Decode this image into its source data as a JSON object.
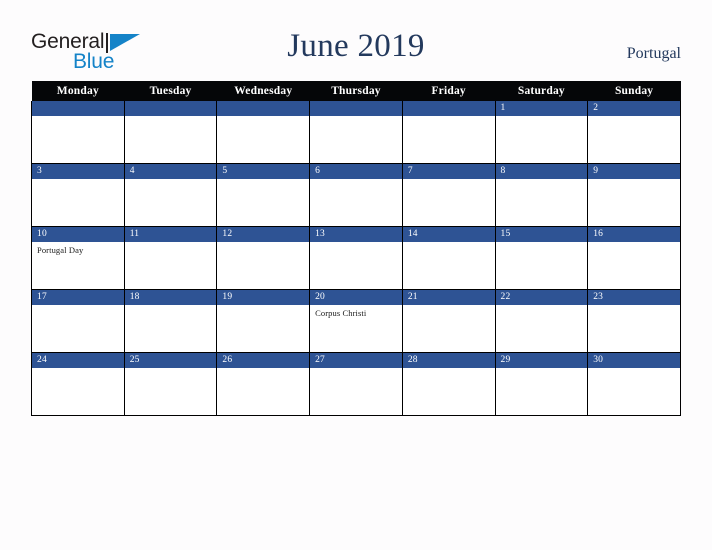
{
  "logo": {
    "word_one": "General",
    "word_two": "Blue",
    "mark": "triangle-logo-mark"
  },
  "header": {
    "title": "June 2019",
    "country": "Portugal"
  },
  "colors": {
    "accent_blue": "#2e5394",
    "logo_blue": "#1583c8",
    "title_navy": "#23395d",
    "header_row": "#050608",
    "page_background": "#fdfcfd",
    "cell_background": "#ffffff",
    "grid_line": "#000000"
  },
  "calendar": {
    "month": "June",
    "year": "2019",
    "weekday_headers": [
      "Monday",
      "Tuesday",
      "Wednesday",
      "Thursday",
      "Friday",
      "Saturday",
      "Sunday"
    ],
    "weeks": [
      [
        {
          "day": "",
          "events": []
        },
        {
          "day": "",
          "events": []
        },
        {
          "day": "",
          "events": []
        },
        {
          "day": "",
          "events": []
        },
        {
          "day": "",
          "events": []
        },
        {
          "day": "1",
          "events": []
        },
        {
          "day": "2",
          "events": []
        }
      ],
      [
        {
          "day": "3",
          "events": []
        },
        {
          "day": "4",
          "events": []
        },
        {
          "day": "5",
          "events": []
        },
        {
          "day": "6",
          "events": []
        },
        {
          "day": "7",
          "events": []
        },
        {
          "day": "8",
          "events": []
        },
        {
          "day": "9",
          "events": []
        }
      ],
      [
        {
          "day": "10",
          "events": [
            "Portugal Day"
          ]
        },
        {
          "day": "11",
          "events": []
        },
        {
          "day": "12",
          "events": []
        },
        {
          "day": "13",
          "events": []
        },
        {
          "day": "14",
          "events": []
        },
        {
          "day": "15",
          "events": []
        },
        {
          "day": "16",
          "events": []
        }
      ],
      [
        {
          "day": "17",
          "events": []
        },
        {
          "day": "18",
          "events": []
        },
        {
          "day": "19",
          "events": []
        },
        {
          "day": "20",
          "events": [
            "Corpus Christi"
          ]
        },
        {
          "day": "21",
          "events": []
        },
        {
          "day": "22",
          "events": []
        },
        {
          "day": "23",
          "events": []
        }
      ],
      [
        {
          "day": "24",
          "events": []
        },
        {
          "day": "25",
          "events": []
        },
        {
          "day": "26",
          "events": []
        },
        {
          "day": "27",
          "events": []
        },
        {
          "day": "28",
          "events": []
        },
        {
          "day": "29",
          "events": []
        },
        {
          "day": "30",
          "events": []
        }
      ]
    ]
  }
}
